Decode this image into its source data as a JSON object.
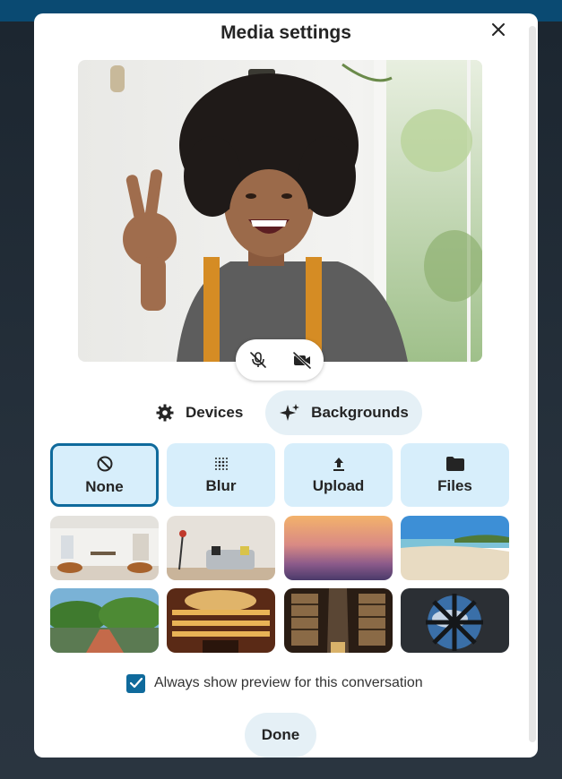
{
  "dialog": {
    "title": "Media settings"
  },
  "tabs": {
    "devices_label": "Devices",
    "backgrounds_label": "Backgrounds"
  },
  "options": [
    {
      "label": "None"
    },
    {
      "label": "Blur"
    },
    {
      "label": "Upload"
    },
    {
      "label": "Files"
    }
  ],
  "backgrounds": [
    "white-loft-room",
    "living-room-sofa",
    "sunset-gradient",
    "sandy-beach",
    "japanese-garden-bridge",
    "opera-theater",
    "library-hall",
    "space-station-window"
  ],
  "preview_option": {
    "label": "Always show preview for this conversation",
    "checked": true
  },
  "footer": {
    "done_label": "Done"
  },
  "colors": {
    "accent": "#0f6a9c",
    "tile_bg": "#d7eefb",
    "pill_bg": "#e5f0f6"
  }
}
